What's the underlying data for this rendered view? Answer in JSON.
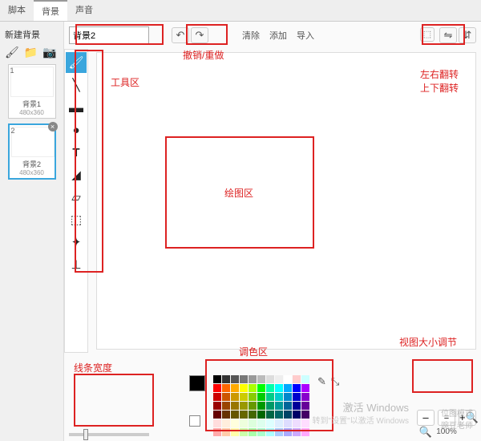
{
  "tabs": {
    "scripts": "脚本",
    "backgrounds": "背景",
    "sounds": "声音"
  },
  "new_section": "新建背景",
  "thumbs": [
    {
      "name": "背景1",
      "size": "480x360"
    },
    {
      "name": "背景2",
      "size": "480x360"
    }
  ],
  "name_input": "背景2",
  "text_buttons": {
    "clear": "清除",
    "add": "添加",
    "import": "导入"
  },
  "zoom": {
    "pct": "100%"
  },
  "annotations": {
    "undo_redo": "撤销/重做",
    "tools": "工具区",
    "flip": "左右翻转\n上下翻转",
    "canvas": "绘图区",
    "view_zoom": "视图大小调节",
    "palette": "调色区",
    "line_width": "线条宽度"
  },
  "watermark": {
    "activate": "激活 Windows",
    "sub": "转到\"设置\"以激活 Windows",
    "mode": "位图模式",
    "teacher": "豌豆老师"
  },
  "palette_colors": [
    "#000",
    "#333",
    "#555",
    "#777",
    "#999",
    "#bbb",
    "#ddd",
    "#eee",
    "#fff",
    "#fcc",
    "#cff",
    "#f00",
    "#f60",
    "#fa0",
    "#ff0",
    "#af0",
    "#0f0",
    "#0fa",
    "#0ff",
    "#0af",
    "#00f",
    "#a0f",
    "#c00",
    "#c50",
    "#c90",
    "#cc0",
    "#8c0",
    "#0c0",
    "#0c8",
    "#0cc",
    "#08c",
    "#00c",
    "#80c",
    "#900",
    "#940",
    "#970",
    "#990",
    "#690",
    "#090",
    "#096",
    "#099",
    "#069",
    "#009",
    "#609",
    "#600",
    "#630",
    "#650",
    "#660",
    "#460",
    "#060",
    "#064",
    "#066",
    "#046",
    "#006",
    "#406",
    "#fdd",
    "#fed",
    "#ffd",
    "#efd",
    "#dfd",
    "#dfe",
    "#dff",
    "#def",
    "#ddf",
    "#edf",
    "#fdf",
    "#faa",
    "#fca",
    "#ffa",
    "#cfa",
    "#afa",
    "#afc",
    "#aff",
    "#acf",
    "#aaf",
    "#caf",
    "#faf"
  ]
}
